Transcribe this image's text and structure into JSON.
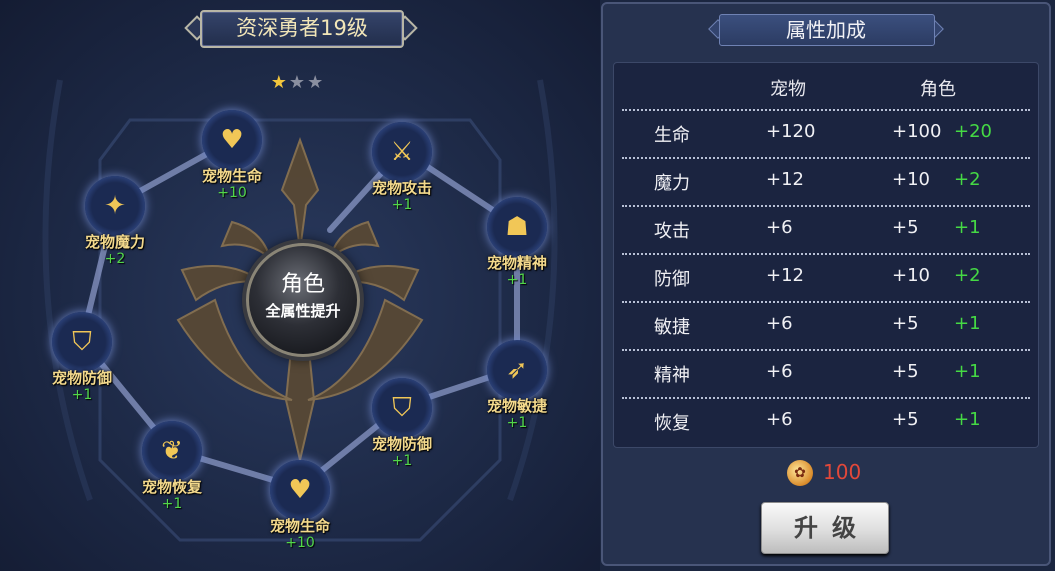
{
  "title": "资深勇者19级",
  "stars": {
    "filled": 1,
    "total": 3
  },
  "center": {
    "title": "角色",
    "subtitle": "全属性提升"
  },
  "nodes": [
    {
      "name": "宠物生命",
      "value": "+10",
      "icon": "heart-icon"
    },
    {
      "name": "宠物攻击",
      "value": "+1",
      "icon": "claw-icon"
    },
    {
      "name": "宠物魔力",
      "value": "+2",
      "icon": "sparkle-icon"
    },
    {
      "name": "宠物精神",
      "value": "+1",
      "icon": "hooded-spirit-icon"
    },
    {
      "name": "宠物防御",
      "value": "+1",
      "icon": "shield-icon"
    },
    {
      "name": "宠物敏捷",
      "value": "+1",
      "icon": "running-figure-icon"
    },
    {
      "name": "宠物防御",
      "value": "+1",
      "icon": "shield-icon"
    },
    {
      "name": "宠物恢复",
      "value": "+1",
      "icon": "heart-hands-icon"
    },
    {
      "name": "宠物生命",
      "value": "+10",
      "icon": "heart-icon"
    }
  ],
  "panel": {
    "title": "属性加成",
    "columns": {
      "pet": "宠物",
      "role": "角色"
    },
    "rows": [
      {
        "name": "生命",
        "pet": "+120",
        "role": "+100",
        "bonus": "+20"
      },
      {
        "name": "魔力",
        "pet": "+12",
        "role": "+10",
        "bonus": "+2"
      },
      {
        "name": "攻击",
        "pet": "+6",
        "role": "+5",
        "bonus": "+1"
      },
      {
        "name": "防御",
        "pet": "+12",
        "role": "+10",
        "bonus": "+2"
      },
      {
        "name": "敏捷",
        "pet": "+6",
        "role": "+5",
        "bonus": "+1"
      },
      {
        "name": "精神",
        "pet": "+6",
        "role": "+5",
        "bonus": "+1"
      },
      {
        "name": "恢复",
        "pet": "+6",
        "role": "+5",
        "bonus": "+1"
      }
    ],
    "cost": {
      "icon": "token-icon",
      "value": "100"
    },
    "button": "升级"
  },
  "colors": {
    "bonus": "#45d944",
    "cost": "#e2483a",
    "node_label": "#f3d98c",
    "star": "#f3c63c"
  }
}
